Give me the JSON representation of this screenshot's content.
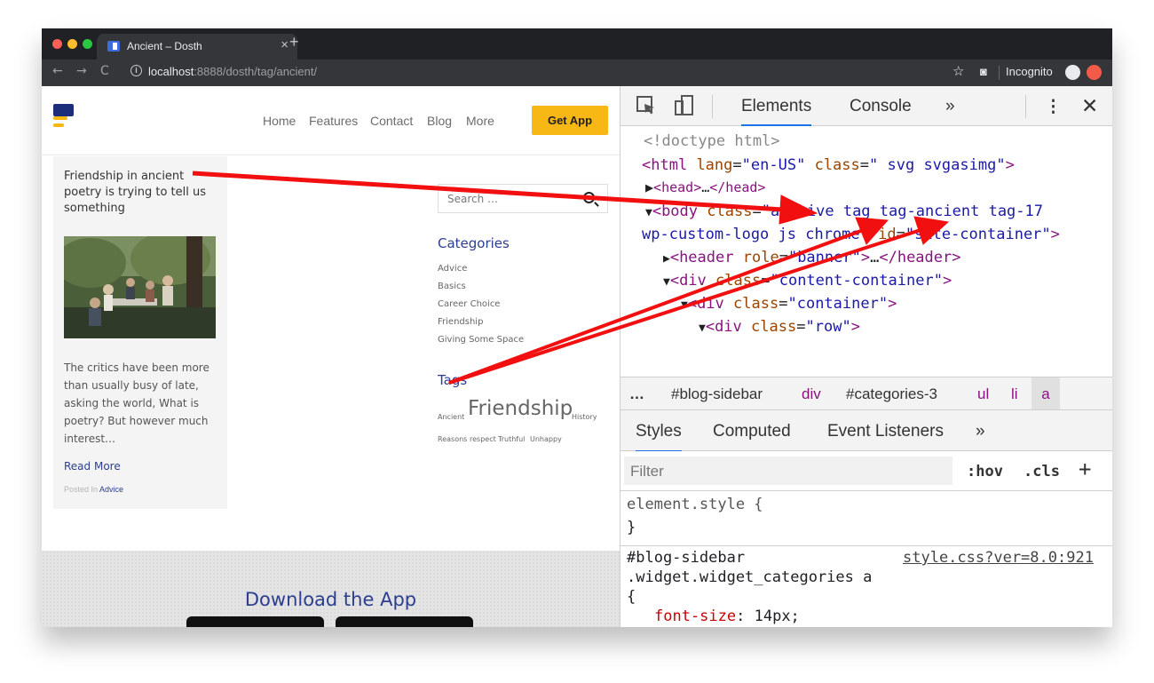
{
  "browser": {
    "tab_title": "Ancient – Dosth",
    "tab_close": "×",
    "new_tab": "+",
    "url_host": "localhost",
    "url_rest": ":8888/dosth/tag/ancient/",
    "incognito_label": "Incognito",
    "traffic_colors": [
      "#fe5f57",
      "#febc2e",
      "#28c840"
    ]
  },
  "site": {
    "nav": [
      "Home",
      "Features",
      "Contact",
      "Blog",
      "More"
    ],
    "cta": "Get App",
    "post": {
      "title": "Friendship in ancient poetry is trying to tell us something",
      "excerpt": "The critics have been more than usually busy of late, asking the world, What is poetry? But however much interest…",
      "read_more": "Read More",
      "posted_in_prefix": "Posted In",
      "posted_in_category": "Advice"
    },
    "search_placeholder": "Search …",
    "categories_heading": "Categories",
    "categories": [
      "Advice",
      "Basics",
      "Career Choice",
      "Friendship",
      "Giving Some Space"
    ],
    "tags_heading": "Tags",
    "tags": [
      "Ancient",
      "Friendship",
      "History",
      "Reasons",
      "respect",
      "Truthful",
      "Unhappy"
    ],
    "download_title": "Download the App",
    "colors": {
      "accent": "#f7b815",
      "brand": "#2c3e8f"
    }
  },
  "devtools": {
    "tabs": [
      "Elements",
      "Console",
      "»"
    ],
    "dom": {
      "doctype": "<!doctype html>",
      "html_lang": "en-US",
      "html_class": " svg svgasimg",
      "head": "head",
      "body_class_1": "archive tag tag-ancient tag-17",
      "body_class_2": "wp-custom-logo js chrome",
      "body_id": "site-container",
      "header_role": "banner",
      "div_content": "content-container",
      "div_container": "container",
      "div_row": "row",
      "ellipsis": "…"
    },
    "breadcrumb": [
      "…",
      "#blog-sidebar",
      "div",
      "#categories-3",
      "ul",
      "li",
      "a"
    ],
    "styles_tabs": [
      "Styles",
      "Computed",
      "Event Listeners",
      "»"
    ],
    "filter_placeholder": "Filter",
    "hov": ":hov",
    "cls": ".cls",
    "plus": "+",
    "element_style": "element.style {",
    "brace_close": "}",
    "rule_selector_1": "#blog-sidebar",
    "rule_selector_2": ".widget.widget_categories a",
    "rule_open": "{",
    "rule_source": "style.css?ver=8.0:921",
    "rule_property": "font-size",
    "rule_value": "14px;"
  }
}
